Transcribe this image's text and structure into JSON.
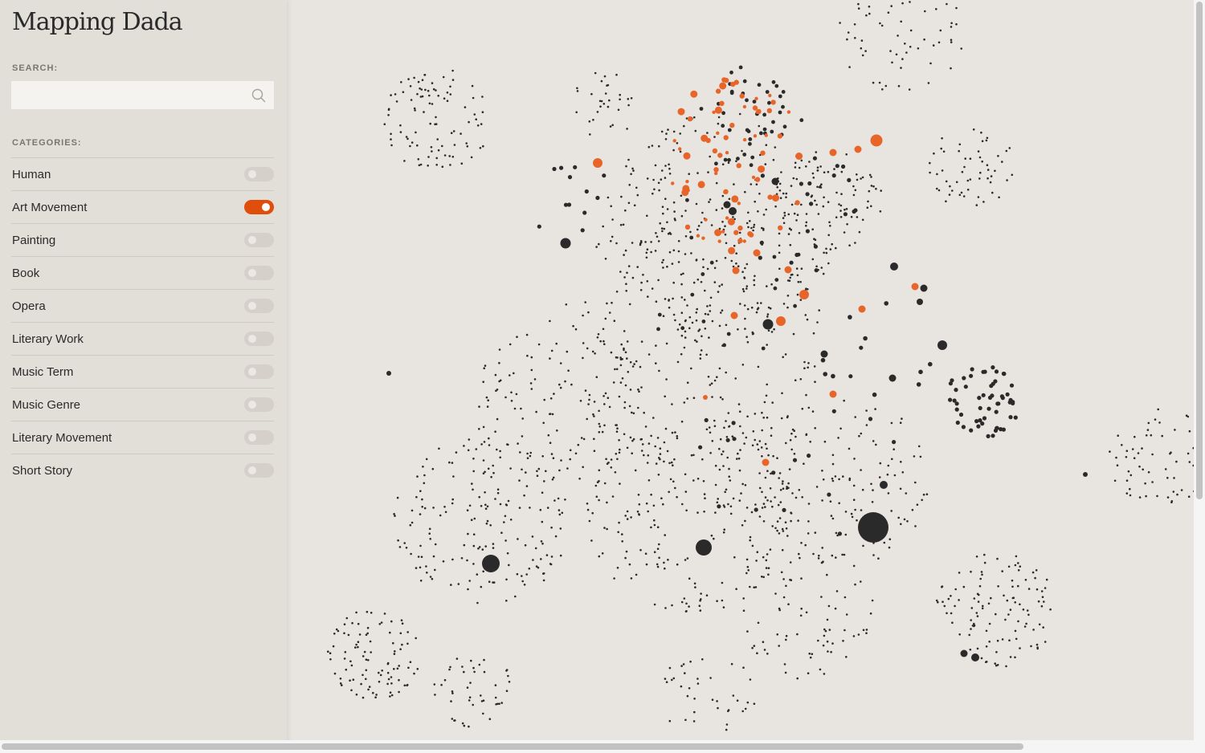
{
  "app": {
    "title": "Mapping Dada"
  },
  "search": {
    "label": "SEARCH:",
    "value": "",
    "placeholder": "",
    "icon": "search-icon"
  },
  "categories": {
    "label": "CATEGORIES:",
    "items": [
      {
        "label": "Human",
        "enabled": false
      },
      {
        "label": "Art Movement",
        "enabled": true
      },
      {
        "label": "Painting",
        "enabled": false
      },
      {
        "label": "Book",
        "enabled": false
      },
      {
        "label": "Opera",
        "enabled": false
      },
      {
        "label": "Literary Work",
        "enabled": false
      },
      {
        "label": "Music Term",
        "enabled": false
      },
      {
        "label": "Music Genre",
        "enabled": false
      },
      {
        "label": "Literary Movement",
        "enabled": false
      },
      {
        "label": "Short Story",
        "enabled": false
      }
    ]
  },
  "colors": {
    "accent": "#e04e0c",
    "node_dark": "#2a2a2a",
    "node_highlight": "#e8652a",
    "background": "#e8e5e0",
    "sidebar": "#e2dfd8"
  }
}
